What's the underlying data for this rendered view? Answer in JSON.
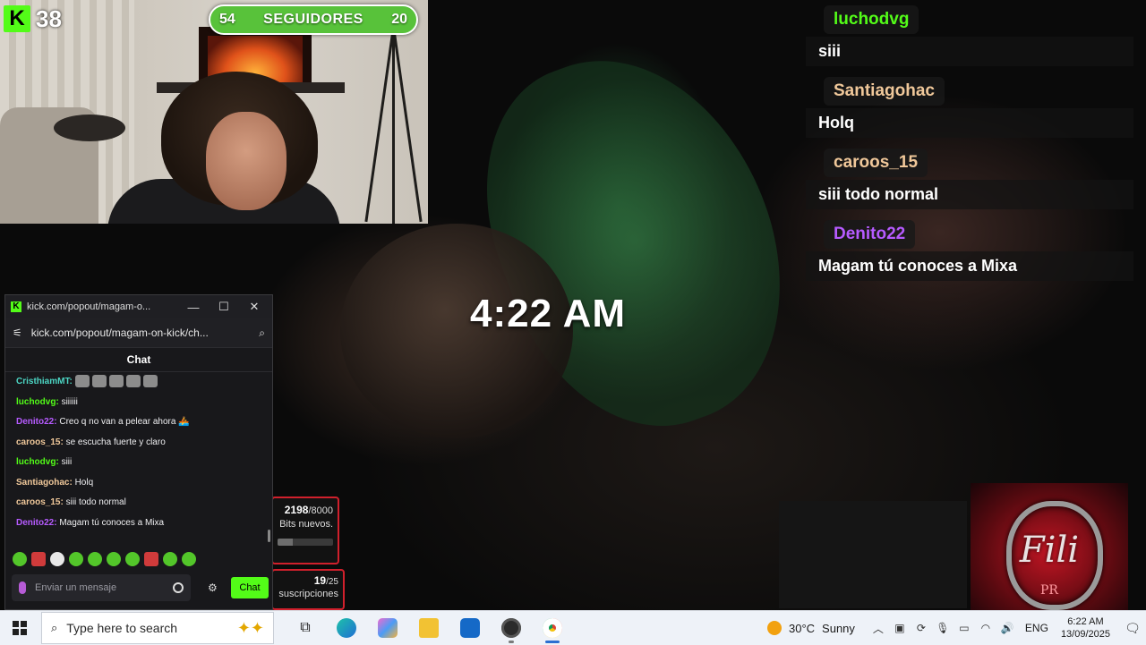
{
  "kick_badge": {
    "logo": "K",
    "count": "38"
  },
  "followers_goal": {
    "left": "54",
    "label": "SEGUIDORES",
    "right": "20"
  },
  "time_overlay": "4:22 AM",
  "overlay_chat": [
    {
      "user": "luchodvg",
      "text": "siii",
      "color": "#53fc18"
    },
    {
      "user": "Santiagohac",
      "text": "Holq",
      "color": "#f0c89a"
    },
    {
      "user": "caroos_15",
      "text": "siii todo normal",
      "color": "#f0c89a"
    },
    {
      "user": "Denito22",
      "text": "Magam tú conoces a Mixa",
      "color": "#b65bff"
    }
  ],
  "bits_goal": {
    "current": "2198",
    "target": "/8000",
    "label": "Bits nuevos.",
    "progress": 0.27
  },
  "subs_goal": {
    "current": "19",
    "target": "/25",
    "label": "suscripciones"
  },
  "fili_logo": {
    "text": "Fili",
    "sub": "PR"
  },
  "popout": {
    "title": "kick.com/popout/magam-o...",
    "url": "kick.com/popout/magam-on-kick/ch...",
    "chat_header": "Chat",
    "messages": [
      {
        "user": "CristhiamMT:",
        "text": "",
        "color": "#4cd6c4",
        "emotes": 5
      },
      {
        "user": "luchodvg:",
        "text": "siiiiii",
        "color": "#53fc18"
      },
      {
        "user": "Denito22:",
        "text": "Creo q no van a pelear ahora 🚣",
        "color": "#b65bff"
      },
      {
        "user": "caroos_15:",
        "text": "se escucha fuerte y claro",
        "color": "#f0c89a"
      },
      {
        "user": "luchodvg:",
        "text": "siii",
        "color": "#53fc18"
      },
      {
        "user": "Santiagohac:",
        "text": "Holq",
        "color": "#f0c89a"
      },
      {
        "user": "caroos_15:",
        "text": "siii todo normal",
        "color": "#f0c89a"
      },
      {
        "user": "Denito22:",
        "text": "Magam tú conoces a Mixa",
        "color": "#b65bff"
      }
    ],
    "input_placeholder": "Enviar un mensaje",
    "send_label": "Chat"
  },
  "taskbar": {
    "search_placeholder": "Type here to search",
    "weather_temp": "30°C",
    "weather_desc": "Sunny",
    "language": "ENG",
    "time": "6:22 AM",
    "date": "13/09/2025"
  },
  "colors": {
    "kick_green": "#53fc18",
    "goal_red": "#d0202c",
    "taskbar": "#eef2f8"
  }
}
